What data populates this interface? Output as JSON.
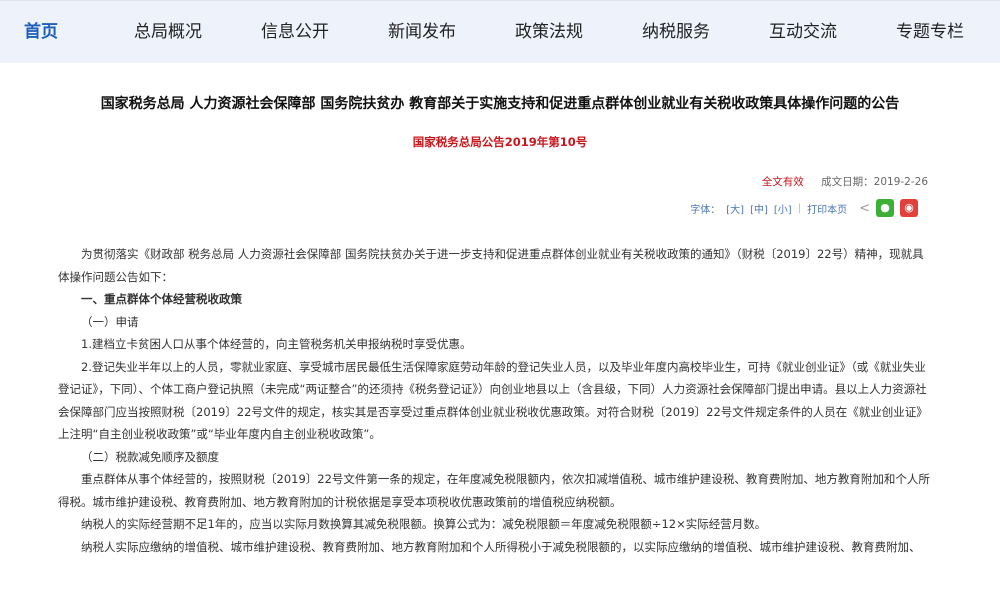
{
  "nav": {
    "items": [
      {
        "label": "首页",
        "active": true
      },
      {
        "label": "总局概况"
      },
      {
        "label": "信息公开"
      },
      {
        "label": "新闻发布"
      },
      {
        "label": "政策法规"
      },
      {
        "label": "纳税服务"
      },
      {
        "label": "互动交流"
      },
      {
        "label": "专题专栏"
      }
    ]
  },
  "article": {
    "title": "国家税务总局 人力资源社会保障部 国务院扶贫办 教育部关于实施支持和促进重点群体创业就业有关税收政策具体操作问题的公告",
    "doc_number": "国家税务总局公告2019年第10号",
    "validity": "全文有效",
    "date": "成文日期：2019-2-26",
    "tools": {
      "font_label": "字体：",
      "large": "[大]",
      "medium": "[中]",
      "small": "[小]",
      "print": "打印本页"
    },
    "paragraphs": [
      "为贯彻落实《财政部 税务总局 人力资源社会保障部 国务院扶贫办关于进一步支持和促进重点群体创业就业有关税收政策的通知》（财税〔2019〕22号）精神，现就具体操作问题公告如下：",
      "一、重点群体个体经营税收政策",
      "（一）申请",
      "1.建档立卡贫困人口从事个体经营的，向主管税务机关申报纳税时享受优惠。",
      "2.登记失业半年以上的人员，零就业家庭、享受城市居民最低生活保障家庭劳动年龄的登记失业人员，以及毕业年度内高校毕业生，可持《就业创业证》（或《就业失业登记证》，下同）、个体工商户登记执照（未完成“两证整合”的还须持《税务登记证》）向创业地县以上（含县级，下同）人力资源社会保障部门提出申请。县以上人力资源社会保障部门应当按照财税〔2019〕22号文件的规定，核实其是否享受过重点群体创业就业税收优惠政策。对符合财税〔2019〕22号文件规定条件的人员在《就业创业证》上注明“自主创业税收政策”或“毕业年度内自主创业税收政策”。",
      "（二）税款减免顺序及额度",
      "重点群体从事个体经营的，按照财税〔2019〕22号文件第一条的规定，在年度减免税限额内，依次扣减增值税、城市维护建设税、教育费附加、地方教育附加和个人所得税。城市维护建设税、教育费附加、地方教育附加的计税依据是享受本项税收优惠政策前的增值税应纳税额。",
      "纳税人的实际经营期不足1年的，应当以实际月数换算其减免税限额。换算公式为：减免税限额＝年度减免税限额÷12×实际经营月数。",
      "纳税人实际应缴纳的增值税、城市维护建设税、教育费附加、地方教育附加和个人所得税小于减免税限额的，以实际应缴纳的增值税、城市维护建设税、教育费附加、"
    ]
  }
}
